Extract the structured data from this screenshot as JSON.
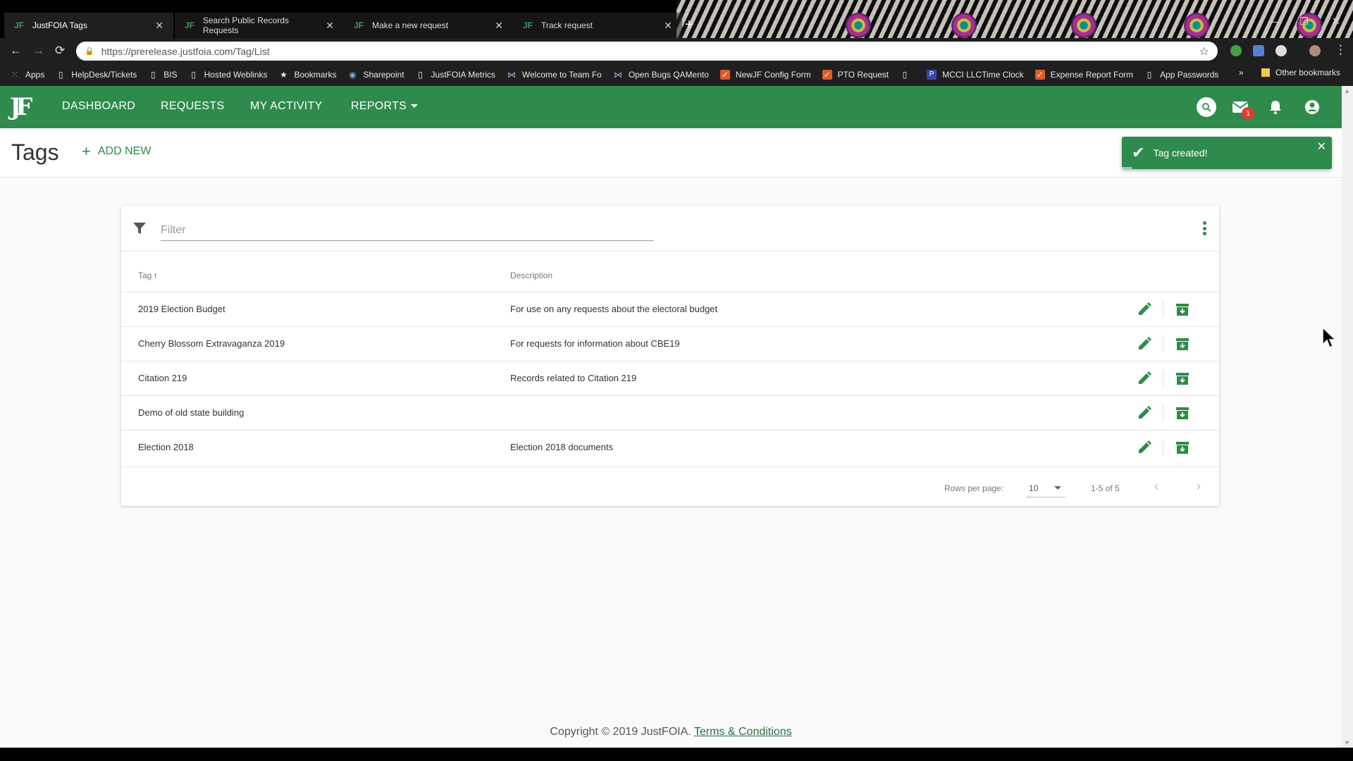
{
  "browser": {
    "tabs": [
      {
        "title": "JustFOIA Tags",
        "active": true
      },
      {
        "title": "Search Public Records Requests",
        "active": false
      },
      {
        "title": "Make a new request",
        "active": false
      },
      {
        "title": "Track request",
        "active": false
      }
    ],
    "url": "https://prerelease.justfoia.com/Tag/List",
    "bookmarks": [
      {
        "label": "Apps",
        "icon": "apps-grid-icon"
      },
      {
        "label": "HelpDesk/Tickets",
        "icon": "page-icon"
      },
      {
        "label": "BIS",
        "icon": "page-icon"
      },
      {
        "label": "Hosted Weblinks",
        "icon": "page-icon"
      },
      {
        "label": "Bookmarks",
        "icon": "star-icon"
      },
      {
        "label": "Sharepoint",
        "icon": "globe-icon"
      },
      {
        "label": "JustFOIA Metrics",
        "icon": "page-icon"
      },
      {
        "label": "Welcome to Team Fo",
        "icon": "vs-icon"
      },
      {
        "label": "Open Bugs QAMento",
        "icon": "vs-icon"
      },
      {
        "label": "NewJF Config Form",
        "icon": "checkbox-icon"
      },
      {
        "label": "PTO Request",
        "icon": "checkbox-icon"
      },
      {
        "label": "",
        "icon": "page-icon"
      },
      {
        "label": "MCCI LLCTime Clock",
        "icon": "p-icon"
      },
      {
        "label": "Expense Report Form",
        "icon": "checkbox-icon"
      },
      {
        "label": "App Passwords",
        "icon": "page-icon"
      }
    ],
    "more": "»",
    "other_bookmarks": "Other bookmarks"
  },
  "app": {
    "logo": "JF",
    "nav": {
      "dashboard": "DASHBOARD",
      "requests": "REQUESTS",
      "my_activity": "MY ACTIVITY",
      "reports": "REPORTS"
    },
    "mail_badge": "1",
    "page_title": "Tags",
    "add_new": "ADD NEW",
    "toast": "Tag created!"
  },
  "table": {
    "filter_placeholder": "Filter",
    "columns": {
      "tag": "Tag",
      "description": "Description"
    },
    "rows": [
      {
        "tag": "2019 Election Budget",
        "description": "For use on any requests about the electoral budget"
      },
      {
        "tag": "Cherry Blossom Extravaganza 2019",
        "description": "For requests for information about CBE19"
      },
      {
        "tag": "Citation 219",
        "description": "Records related to Citation 219"
      },
      {
        "tag": "Demo of old state building",
        "description": ""
      },
      {
        "tag": "Election 2018",
        "description": "Election 2018 documents"
      }
    ],
    "rows_per_page_label": "Rows per page:",
    "rows_per_page": "10",
    "page_range": "1-5 of 5"
  },
  "footer": {
    "copyright": "Copyright © 2019 JustFOIA.",
    "terms": "Terms & Conditions"
  },
  "colors": {
    "brand_green": "#2e8b4c",
    "danger_red": "#e53935"
  }
}
